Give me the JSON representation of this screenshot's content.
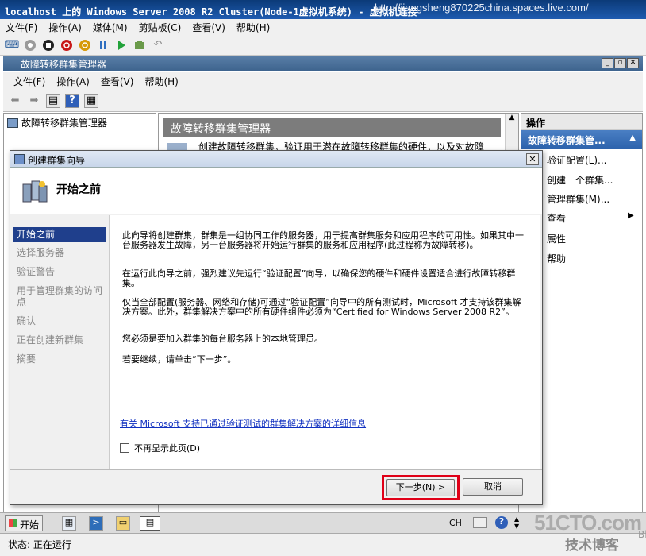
{
  "vm": {
    "title": "localhost 上的 Windows Server 2008 R2 Cluster(Node-1虚拟机系统) - 虚拟机连接",
    "watermark": "http://jiangsheng870225china.spaces.live.com/",
    "menu": [
      "文件(F)",
      "操作(A)",
      "媒体(M)",
      "剪贴板(C)",
      "查看(V)",
      "帮助(H)"
    ]
  },
  "mmc": {
    "title": "故障转移群集管理器",
    "menu": [
      "文件(F)",
      "操作(A)",
      "查看(V)",
      "帮助(H)"
    ],
    "tree_root": "故障转移群集管理器",
    "center_header": "故障转移群集管理器",
    "center_desc": "创建故障转移群集，验证用于潜在故障转移群集的硬件，以及对故障",
    "actions": {
      "header": "操作",
      "group": "故障转移群集管...",
      "items": [
        "验证配置(L)...",
        "创建一个群集...",
        "管理群集(M)...",
        "查看",
        "属性",
        "帮助"
      ]
    }
  },
  "dialog": {
    "title": "创建群集向导",
    "page_title": "开始之前",
    "steps": [
      "开始之前",
      "选择服务器",
      "验证警告",
      "用于管理群集的访问点",
      "确认",
      "正在创建新群集",
      "摘要"
    ],
    "paragraphs": [
      "此向导将创建群集，群集是一组协同工作的服务器，用于提高群集服务和应用程序的可用性。如果其中一台服务器发生故障，另一台服务器将开始运行群集的服务和应用程序(此过程称为故障转移)。",
      "在运行此向导之前，强烈建议先运行“验证配置”向导，以确保您的硬件和硬件设置适合进行故障转移群集。",
      "仅当全部配置(服务器、网络和存储)可通过“验证配置”向导中的所有测试时，Microsoft 才支持该群集解决方案。此外，群集解决方案中的所有硬件组件必须为“Certified for Windows Server 2008 R2”。",
      "您必须是要加入群集的每台服务器上的本地管理员。",
      "若要继续，请单击“下一步”。"
    ],
    "link": "有关 Microsoft 支持已通过验证测试的群集解决方案的详细信息",
    "checkbox_label": "不再显示此页(D)",
    "next_button": "下一步(N) >",
    "cancel_button": "取消"
  },
  "taskbar": {
    "start": "开始",
    "lang": "CH"
  },
  "status": {
    "text": "状态: 正在运行"
  },
  "brand": {
    "site": "51CTO.com",
    "blog": "技术博客",
    "blog_suffix": "Blog"
  }
}
